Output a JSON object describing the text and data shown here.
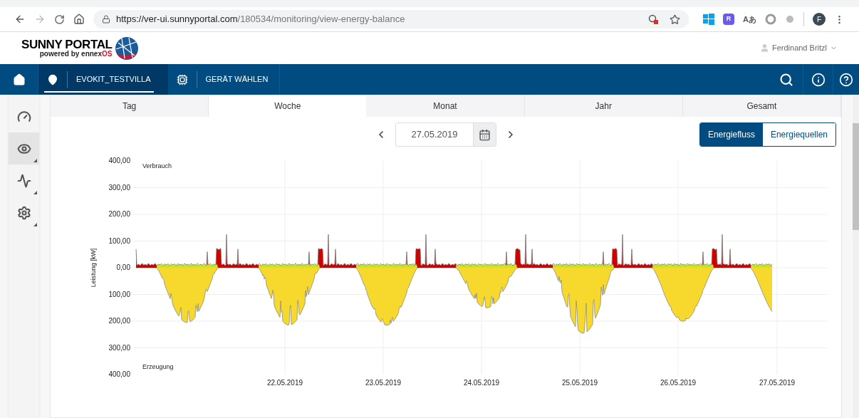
{
  "browser": {
    "url_host": "https://ver-ui.sunnyportal.com",
    "url_path": "/180534/monitoring/view-energy-balance",
    "forward_disabled": true,
    "extensions": [
      {
        "kind": "windows"
      },
      {
        "kind": "hexagon",
        "label": "R"
      },
      {
        "kind": "translate",
        "label": "Aあ"
      },
      {
        "kind": "ring"
      },
      {
        "kind": "dot"
      }
    ],
    "profile_initial": "F"
  },
  "header": {
    "logo_title": "SUNNY PORTAL",
    "logo_powered": "powered by ennex",
    "logo_os": "OS",
    "user": "Ferdinand Britzl"
  },
  "nav": {
    "breadcrumbs": [
      {
        "kind": "location",
        "label": "EVOKIT_TESTVILLA",
        "selected": true
      },
      {
        "kind": "device",
        "label": "GERÄT WÄHLEN",
        "selected": false
      }
    ]
  },
  "sidebar": {
    "items": [
      {
        "kind": "gauge",
        "selected": false,
        "has_submenu": false
      },
      {
        "kind": "eye",
        "selected": true,
        "has_submenu": true
      },
      {
        "kind": "pulse",
        "selected": false,
        "has_submenu": true
      },
      {
        "kind": "gear",
        "selected": false,
        "has_submenu": true
      }
    ]
  },
  "tabs": [
    {
      "label": "Tag",
      "selected": false
    },
    {
      "label": "Woche",
      "selected": true
    },
    {
      "label": "Monat",
      "selected": false
    },
    {
      "label": "Jahr",
      "selected": false
    },
    {
      "label": "Gesamt",
      "selected": false
    }
  ],
  "date": {
    "value": "27.05.2019"
  },
  "view_toggle": [
    {
      "label": "Energiefluss",
      "selected": true
    },
    {
      "label": "Energiequellen",
      "selected": false
    }
  ],
  "chart": {
    "ylabel": "Leistung [kW]",
    "top_label": "Verbrauch",
    "bottom_label": "Erzeugung",
    "yticks": [
      "400,00",
      "300,00",
      "200,00",
      "100,00",
      "0,00",
      "100,00",
      "200,00",
      "300,00",
      "400,00"
    ],
    "xticks": [
      "22.05.2019",
      "23.05.2019",
      "24.05.2019",
      "25.05.2019",
      "26.05.2019",
      "27.05.2019"
    ]
  }
}
